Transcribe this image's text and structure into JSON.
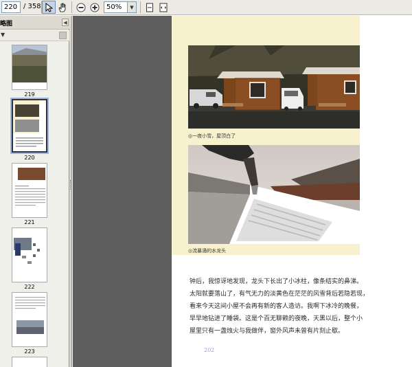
{
  "toolbar": {
    "current_page": "220",
    "total_pages": "/ 358",
    "zoom_value": "50%",
    "icons": [
      "select-arrow-icon",
      "hand-tool-icon",
      "zoom-out-icon",
      "zoom-in-icon",
      "fit-page-icon",
      "fit-width-icon"
    ],
    "zoom_dropdown_icon": "chevron-down-icon"
  },
  "sidebar": {
    "panel_title": "略图",
    "thumbnails": [
      {
        "label": "219"
      },
      {
        "label": "220",
        "selected": true
      },
      {
        "label": "221"
      },
      {
        "label": "222"
      },
      {
        "label": "223"
      }
    ]
  },
  "page": {
    "caption_1": "◎一夜小雪，屋顶白了",
    "caption_2": "◎流暴涌的水龙头",
    "body_lines": [
      "钟后，我惊讶地发现，龙头下长出了小冰柱，像条结实的鼻涕。",
      "太阳就要落山了，有气无力的淡黄色在茫茫的风雪背后若隐若现，",
      "看来今天这间小屋不会再有新的客人造访。我啊下冰冷的晚餐，",
      "早早地钻进了睡袋。这是个百无聊赖的夜晚，天黑以后，整个小",
      "屋里只有一盏烛火与我做伴，窗外风声未曾有片刻止歇。"
    ],
    "page_number": "202"
  },
  "colors": {
    "toolbar_bg": "#eceae3",
    "doc_bg": "#5e5e5e",
    "page_band": "#f7f2cd",
    "selection": "#9bb5dd"
  }
}
